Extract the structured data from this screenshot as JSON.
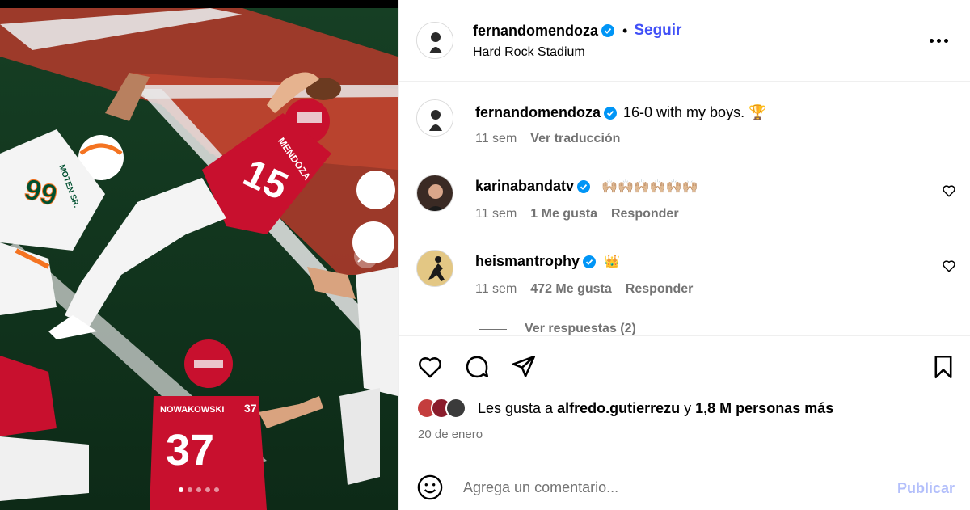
{
  "post": {
    "author": "fernandomendoza",
    "follow_label": "Seguir",
    "dot": "•",
    "location": "Hard Rock Stadium",
    "slide_count": 5,
    "active_slide": 1
  },
  "media": {
    "jersey_main_number": "15",
    "jersey_main_name": "MENDOZA",
    "jersey_bottom_number": "37",
    "jersey_bottom_name": "NOWAKOWSKI",
    "jersey_left_number": "99",
    "jersey_left_name": "MOTEN SR."
  },
  "comments": [
    {
      "user": "fernandomendoza",
      "text": "16-0 with my boys. 🏆",
      "time": "11 sem",
      "action": "Ver traducción"
    },
    {
      "user": "karinabandatv",
      "text": "🙌🏼🙌🏼🙌🏼🙌🏼🙌🏼🙌🏼",
      "time": "11 sem",
      "likes": "1 Me gusta",
      "reply": "Responder"
    },
    {
      "user": "heismantrophy",
      "text": "👑",
      "time": "11 sem",
      "likes": "472 Me gusta",
      "reply": "Responder"
    }
  ],
  "view_replies": "Ver respuestas (2)",
  "likes_summary": {
    "prefix": "Les gusta a",
    "user": "alfredo.gutierrezu",
    "joiner": "y",
    "rest": "1,8 M personas más"
  },
  "date": "20 de enero",
  "comment_box": {
    "placeholder": "Agrega un comentario...",
    "publish_label": "Publicar"
  },
  "colors": {
    "accent": "#4150f7",
    "verified": "#0095f6",
    "muted": "#737373",
    "publish_disabled": "#b3bffb",
    "miami_orange": "#f47321",
    "miami_green": "#005030",
    "indiana_crimson": "#c8102e"
  },
  "icons": [
    "more-icon",
    "heart-icon",
    "comment-icon",
    "share-icon",
    "bookmark-icon",
    "emoji-icon",
    "verified-icon",
    "next-arrow-icon"
  ]
}
